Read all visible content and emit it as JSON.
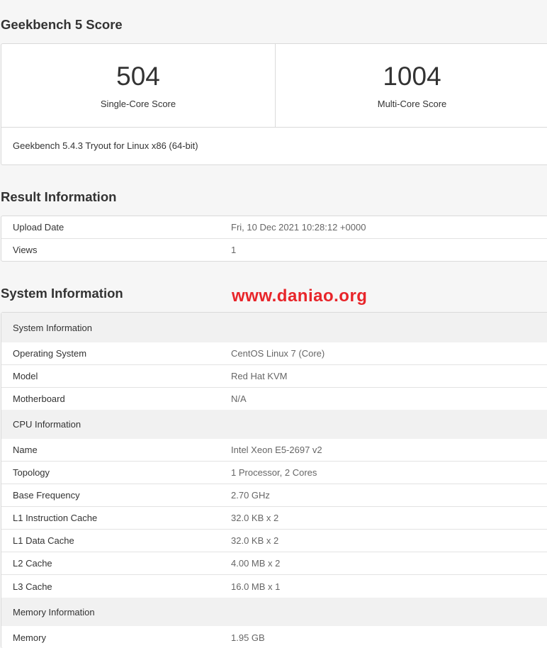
{
  "score_section": {
    "title": "Geekbench 5 Score",
    "single_core": {
      "value": "504",
      "label": "Single-Core Score"
    },
    "multi_core": {
      "value": "1004",
      "label": "Multi-Core Score"
    },
    "version": "Geekbench 5.4.3 Tryout for Linux x86 (64-bit)"
  },
  "result_section": {
    "title": "Result Information",
    "rows": [
      {
        "name": "Upload Date",
        "value": "Fri, 10 Dec 2021 10:28:12 +0000"
      },
      {
        "name": "Views",
        "value": "1"
      }
    ]
  },
  "system_section": {
    "title": "System Information",
    "watermark": "www.daniao.org",
    "groups": [
      {
        "header": "System Information",
        "rows": [
          {
            "name": "Operating System",
            "value": "CentOS Linux 7 (Core)"
          },
          {
            "name": "Model",
            "value": "Red Hat KVM"
          },
          {
            "name": "Motherboard",
            "value": "N/A"
          }
        ]
      },
      {
        "header": "CPU Information",
        "rows": [
          {
            "name": "Name",
            "value": "Intel Xeon E5-2697 v2"
          },
          {
            "name": "Topology",
            "value": "1 Processor, 2 Cores"
          },
          {
            "name": "Base Frequency",
            "value": "2.70 GHz"
          },
          {
            "name": "L1 Instruction Cache",
            "value": "32.0 KB x 2"
          },
          {
            "name": "L1 Data Cache",
            "value": "32.0 KB x 2"
          },
          {
            "name": "L2 Cache",
            "value": "4.00 MB x 2"
          },
          {
            "name": "L3 Cache",
            "value": "16.0 MB x 1"
          }
        ]
      },
      {
        "header": "Memory Information",
        "rows": [
          {
            "name": "Memory",
            "value": "1.95 GB"
          }
        ]
      }
    ]
  },
  "colors": {
    "background": "#f6f6f6",
    "card": "#ffffff",
    "group_header": "#f1f1f1",
    "watermark": "#e8252a"
  }
}
